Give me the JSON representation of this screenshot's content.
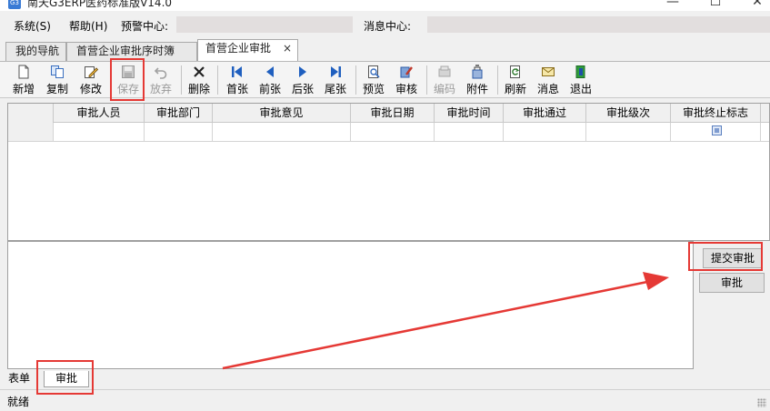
{
  "window": {
    "title": "南天G3ERP医药标准版V14.0",
    "icon": "app-logo-icon",
    "controls": [
      "minimize-icon",
      "maximize-icon",
      "close-icon"
    ]
  },
  "menu": {
    "system": "系统(S)",
    "help": "帮助(H)",
    "alert_center": "预警中心:",
    "message_center": "消息中心:"
  },
  "tabs": [
    {
      "label": "我的导航"
    },
    {
      "label": "首营企业审批序时簿"
    },
    {
      "label": "首营企业审批",
      "close": "×"
    }
  ],
  "toolbar": {
    "buttons": [
      {
        "label": "新增",
        "icon": "new-document-icon"
      },
      {
        "label": "复制",
        "icon": "copy-icon"
      },
      {
        "label": "修改",
        "icon": "edit-icon"
      },
      {
        "label": "保存",
        "icon": "save-icon",
        "disabled": true
      },
      {
        "label": "放弃",
        "icon": "undo-icon",
        "disabled": true
      },
      {
        "label": "删除",
        "icon": "delete-icon"
      },
      {
        "label": "首张",
        "icon": "first-record-icon"
      },
      {
        "label": "前张",
        "icon": "previous-record-icon"
      },
      {
        "label": "后张",
        "icon": "next-record-icon"
      },
      {
        "label": "尾张",
        "icon": "last-record-icon"
      },
      {
        "label": "预览",
        "icon": "print-preview-icon"
      },
      {
        "label": "审核",
        "icon": "audit-icon"
      },
      {
        "label": "编码",
        "icon": "code-icon",
        "disabled": true
      },
      {
        "label": "附件",
        "icon": "attachment-icon"
      },
      {
        "label": "刷新",
        "icon": "refresh-icon"
      },
      {
        "label": "消息",
        "icon": "message-icon"
      },
      {
        "label": "退出",
        "icon": "exit-icon"
      }
    ]
  },
  "grid": {
    "columns": [
      "审批人员",
      "审批部门",
      "审批意见",
      "审批日期",
      "审批时间",
      "审批通过",
      "审批级次",
      "审批终止标志"
    ]
  },
  "actions": {
    "submit_approval": "提交审批",
    "approve": "审批"
  },
  "bottom_tabs": [
    {
      "label": "表单"
    },
    {
      "label": "审批"
    }
  ],
  "status": {
    "text": "就绪"
  },
  "colors": {
    "highlight": "#e53935",
    "toolbar_blue": "#1f5fbf"
  }
}
